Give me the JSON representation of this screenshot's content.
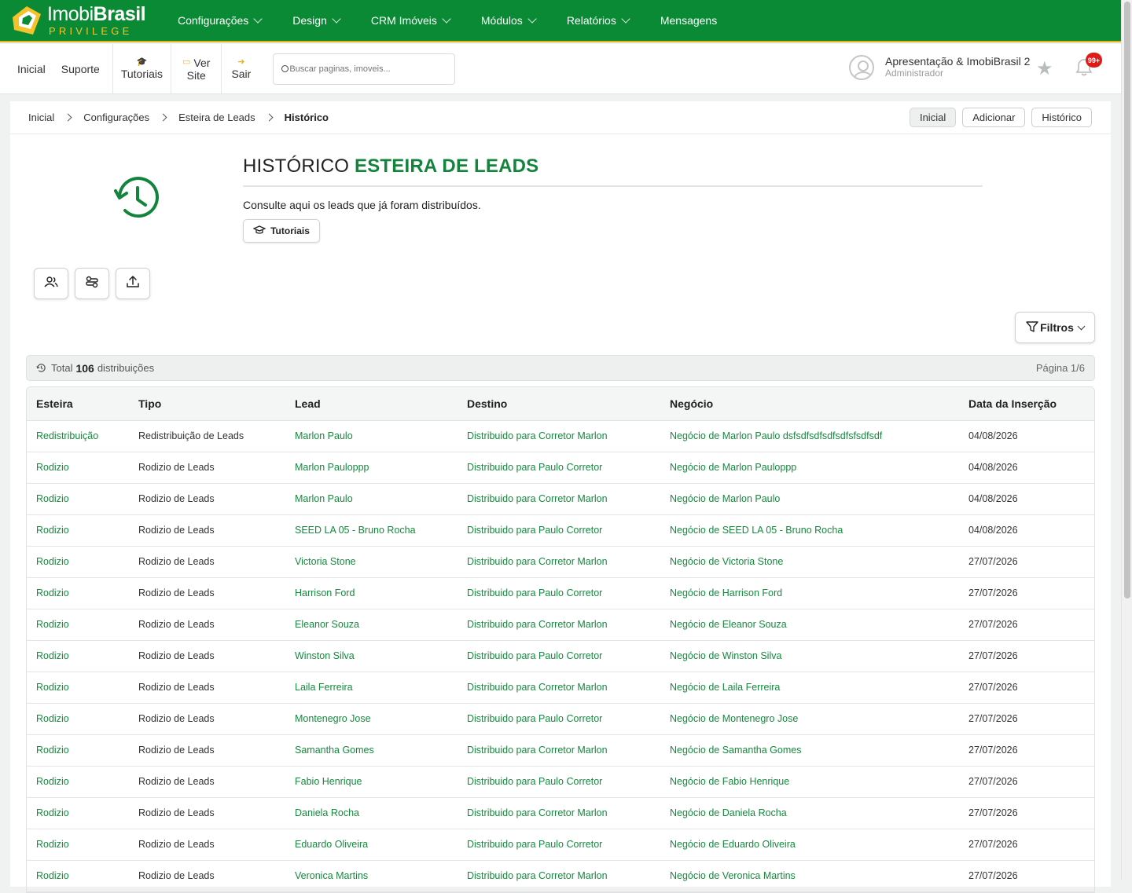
{
  "brand": {
    "name_light": "Imobi",
    "name_bold": "Brasil",
    "tagline": "PRIVILEGE",
    "accent": "#0b8a35",
    "gold": "#e9b41d"
  },
  "nav": [
    {
      "label": "Configurações"
    },
    {
      "label": "Design"
    },
    {
      "label": "CRM Imóveis"
    },
    {
      "label": "Módulos"
    },
    {
      "label": "Relatórios"
    },
    {
      "label": "Mensagens"
    }
  ],
  "subbar": {
    "inicial": "Inicial",
    "suporte": "Suporte",
    "tutoriais": "Tutoriais",
    "ver": "Ver",
    "site": "Site",
    "sair": "Sair",
    "search_placeholder": "Buscar paginas, imoveis...",
    "user_name": "Apresentação & ImobiBrasil 2",
    "user_role": "Administrador",
    "notif_count": "99+"
  },
  "breadcrumb": [
    "Inicial",
    "Configurações",
    "Esteira de Leads",
    "Histórico"
  ],
  "crumb_actions": [
    "Inicial",
    "Adicionar",
    "Histórico"
  ],
  "hero": {
    "title_plain": "HISTÓRICO",
    "title_accent": "ESTEIRA DE LEADS",
    "description": "Consulte aqui os leads que já foram distribuídos.",
    "tutorials_button": "Tutoriais"
  },
  "icons": [
    "users-icon",
    "settings-flow-icon",
    "upload-icon",
    "history-icon",
    "filter-icon"
  ],
  "filters_label": "Filtros",
  "summary": {
    "prefix": "Total",
    "total": "106",
    "suffix": "distribuições",
    "page": "Página 1/6"
  },
  "table": {
    "columns": [
      "Esteira",
      "Tipo",
      "Lead",
      "Destino",
      "Negócio",
      "Data da Inserção"
    ],
    "rows": [
      [
        "Redistribuição",
        "Redistribuição de Leads",
        "Marlon Paulo",
        "Distribuido para Corretor Marlon",
        "Negócio de Marlon Paulo dsfsdfsdfsdfsdfsfsdfsdf",
        "04/08/2026"
      ],
      [
        "Rodizio",
        "Rodizio de Leads",
        "Marlon Pauloppp",
        "Distribuido para Paulo Corretor",
        "Negócio de Marlon Pauloppp",
        "04/08/2026"
      ],
      [
        "Rodizio",
        "Rodizio de Leads",
        "Marlon Paulo",
        "Distribuido para Corretor Marlon",
        "Negócio de Marlon Paulo",
        "04/08/2026"
      ],
      [
        "Rodizio",
        "Rodizio de Leads",
        "SEED LA 05 - Bruno Rocha",
        "Distribuido para Paulo Corretor",
        "Negócio de SEED LA 05 - Bruno Rocha",
        "04/08/2026"
      ],
      [
        "Rodizio",
        "Rodizio de Leads",
        "Victoria Stone",
        "Distribuido para Corretor Marlon",
        "Negócio de Victoria Stone",
        "27/07/2026"
      ],
      [
        "Rodizio",
        "Rodizio de Leads",
        "Harrison Ford",
        "Distribuido para Paulo Corretor",
        "Negócio de Harrison Ford",
        "27/07/2026"
      ],
      [
        "Rodizio",
        "Rodizio de Leads",
        "Eleanor Souza",
        "Distribuido para Corretor Marlon",
        "Negócio de Eleanor Souza",
        "27/07/2026"
      ],
      [
        "Rodizio",
        "Rodizio de Leads",
        "Winston Silva",
        "Distribuido para Paulo Corretor",
        "Negócio de Winston Silva",
        "27/07/2026"
      ],
      [
        "Rodizio",
        "Rodizio de Leads",
        "Laila Ferreira",
        "Distribuido para Corretor Marlon",
        "Negócio de Laila Ferreira",
        "27/07/2026"
      ],
      [
        "Rodizio",
        "Rodizio de Leads",
        "Montenegro Jose",
        "Distribuido para Paulo Corretor",
        "Negócio de Montenegro Jose",
        "27/07/2026"
      ],
      [
        "Rodizio",
        "Rodizio de Leads",
        "Samantha Gomes",
        "Distribuido para Corretor Marlon",
        "Negócio de Samantha Gomes",
        "27/07/2026"
      ],
      [
        "Rodizio",
        "Rodizio de Leads",
        "Fabio Henrique",
        "Distribuido para Paulo Corretor",
        "Negócio de Fabio Henrique",
        "27/07/2026"
      ],
      [
        "Rodizio",
        "Rodizio de Leads",
        "Daniela Rocha",
        "Distribuido para Corretor Marlon",
        "Negócio de Daniela Rocha",
        "27/07/2026"
      ],
      [
        "Rodizio",
        "Rodizio de Leads",
        "Eduardo Oliveira",
        "Distribuido para Paulo Corretor",
        "Negócio de Eduardo Oliveira",
        "27/07/2026"
      ],
      [
        "Rodizio",
        "Rodizio de Leads",
        "Veronica Martins",
        "Distribuido para Corretor Marlon",
        "Negócio de Veronica Martins",
        "27/07/2026"
      ]
    ]
  }
}
